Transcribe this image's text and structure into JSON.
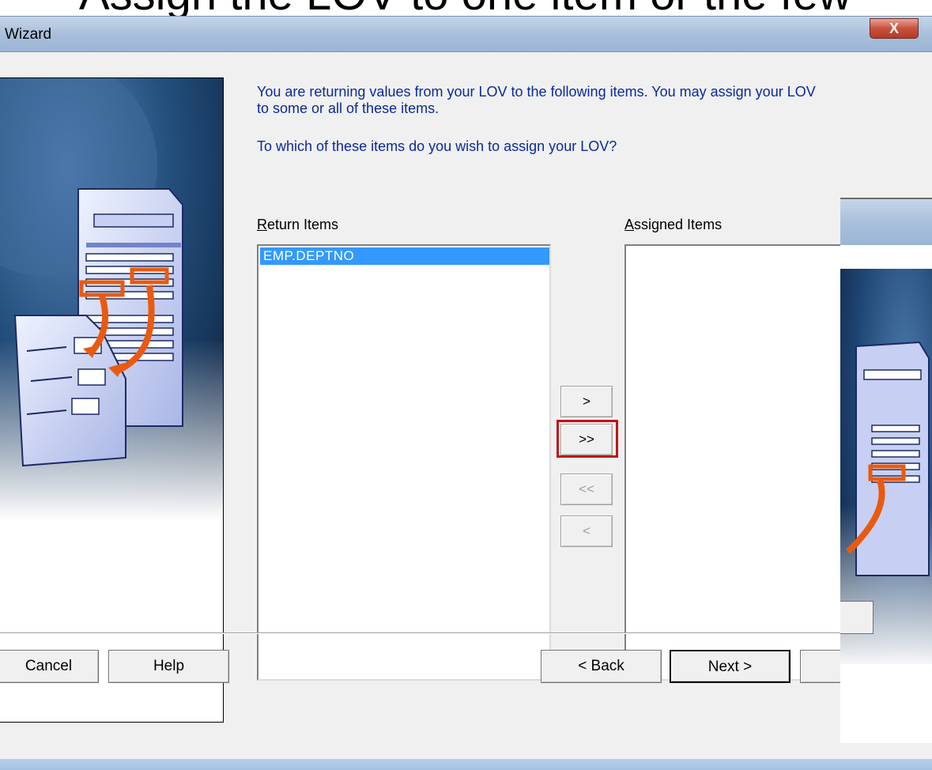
{
  "slide": {
    "title_fragment": "Assign the LOV to one item or the few"
  },
  "window": {
    "title": "Wizard",
    "close_label": "X"
  },
  "instructions": {
    "line1": "You are returning values from your LOV to the following items. You may assign your LOV",
    "line2": "to some or all of these items.",
    "question": "To which of these items do you wish to assign your LOV?"
  },
  "return_items": {
    "label_mnemonic": "R",
    "label_rest": "eturn Items",
    "items": [
      "EMP.DEPTNO"
    ]
  },
  "assigned_items": {
    "label_mnemonic": "A",
    "label_rest": "ssigned Items",
    "items": []
  },
  "move_buttons": {
    "add_one": ">",
    "add_all": ">>",
    "remove_all": "<<",
    "remove_one": "<"
  },
  "footer": {
    "cancel": "Cancel",
    "help": "Help",
    "back": "< Back",
    "next": "Next >"
  },
  "colors": {
    "instruction_text": "#0a2a9c",
    "selection": "#3399ff",
    "highlight_box": "#c0121a",
    "close_button": "#c8513d"
  },
  "icons": {
    "art": "wizard-illustration-image",
    "close": "close-icon"
  }
}
